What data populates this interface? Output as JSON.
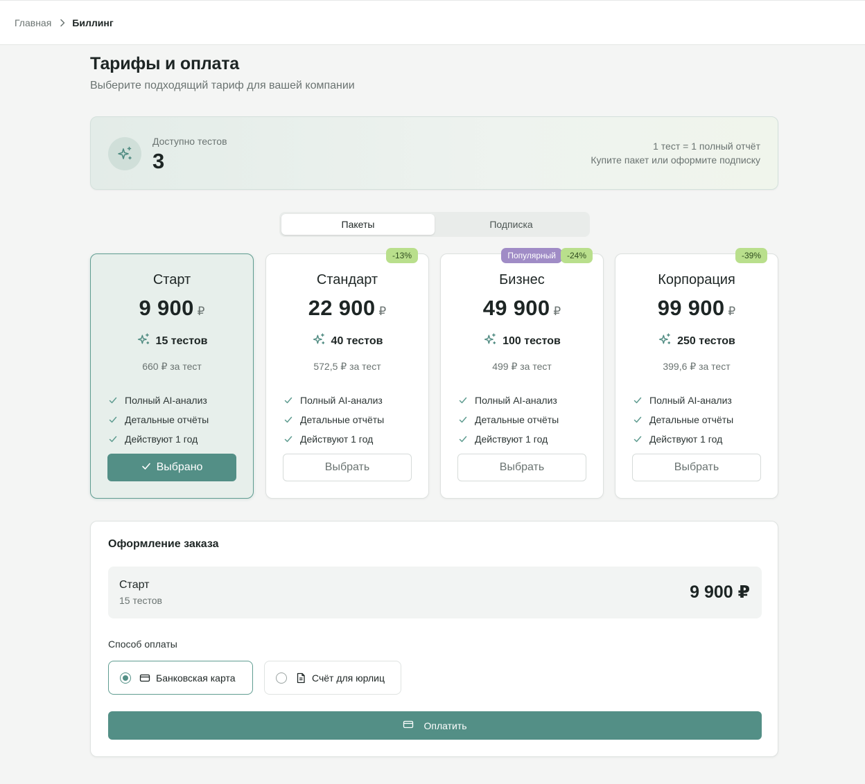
{
  "breadcrumb": {
    "home": "Главная",
    "current": "Биллинг"
  },
  "page": {
    "title": "Тарифы и оплата",
    "subtitle": "Выберите подходящий тариф для вашей компании"
  },
  "balance": {
    "label": "Доступно тестов",
    "value": "3",
    "note1": "1 тест = 1 полный отчёт",
    "note2": "Купите пакет или оформите подписку",
    "icon": "sparkles-icon"
  },
  "tabs": [
    {
      "label": "Пакеты",
      "active": true
    },
    {
      "label": "Подписка",
      "active": false
    }
  ],
  "plans": [
    {
      "name": "Старт",
      "price": "9 900",
      "currency": "₽",
      "tests": "15 тестов",
      "per_test": "660 ₽ за тест",
      "features": [
        "Полный AI-анализ",
        "Детальные отчёты",
        "Действуют 1 год"
      ],
      "button": "Выбрано",
      "selected": true,
      "badges": []
    },
    {
      "name": "Стандарт",
      "price": "22 900",
      "currency": "₽",
      "tests": "40 тестов",
      "per_test": "572,5 ₽ за тест",
      "features": [
        "Полный AI-анализ",
        "Детальные отчёты",
        "Действуют 1 год"
      ],
      "button": "Выбрать",
      "selected": false,
      "badges": [
        "-13%"
      ]
    },
    {
      "name": "Бизнес",
      "price": "49 900",
      "currency": "₽",
      "tests": "100 тестов",
      "per_test": "499 ₽ за тест",
      "features": [
        "Полный AI-анализ",
        "Детальные отчёты",
        "Действуют 1 год"
      ],
      "button": "Выбрать",
      "selected": false,
      "badges": [
        "Популярный",
        "-24%"
      ]
    },
    {
      "name": "Корпорация",
      "price": "99 900",
      "currency": "₽",
      "tests": "250 тестов",
      "per_test": "399,6 ₽ за тест",
      "features": [
        "Полный AI-анализ",
        "Детальные отчёты",
        "Действуют 1 год"
      ],
      "button": "Выбрать",
      "selected": false,
      "badges": [
        "-39%"
      ]
    }
  ],
  "order": {
    "title": "Оформление заказа",
    "plan_name": "Старт",
    "plan_tests": "15 тестов",
    "total": "9 900 ₽",
    "payment_label": "Способ оплаты",
    "payment_options": [
      {
        "label": "Банковская карта",
        "icon": "credit-card-icon",
        "selected": true
      },
      {
        "label": "Счёт для юрлиц",
        "icon": "document-icon",
        "selected": false
      }
    ],
    "pay_button": "Оплатить"
  },
  "colors": {
    "accent": "#538f86",
    "badge_discount": "#b9df8c",
    "badge_popular": "#a08cc6",
    "background": "#f4f5f4"
  }
}
